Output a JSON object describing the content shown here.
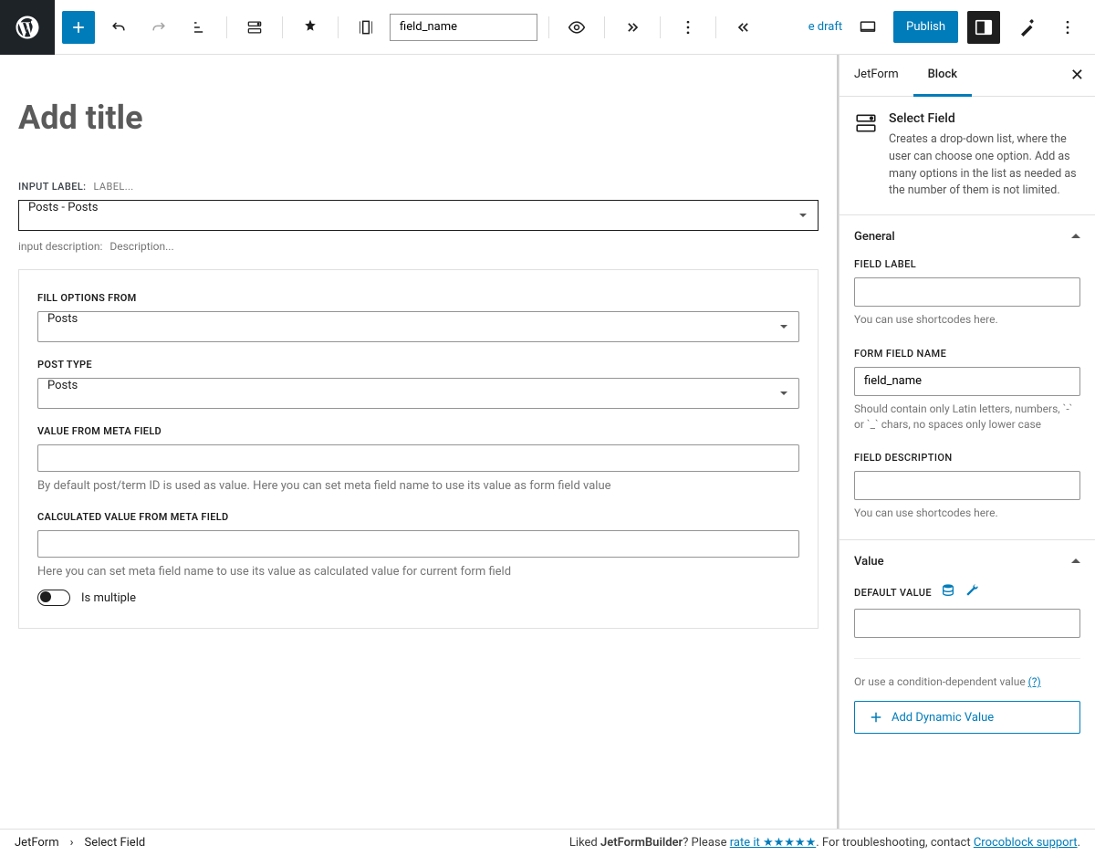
{
  "topbar": {
    "field_name_value": "field_name",
    "save_draft_partial": "e draft",
    "publish": "Publish"
  },
  "editor": {
    "title_placeholder": "Add title",
    "input_label_prefix": "INPUT LABEL:",
    "input_label_placeholder": "LABEL...",
    "select_value": "Posts - Posts",
    "input_desc_prefix": "input description:",
    "input_desc_placeholder": "Description...",
    "options": {
      "fill_from_label": "FILL OPTIONS FROM",
      "fill_from_value": "Posts",
      "post_type_label": "POST TYPE",
      "post_type_value": "Posts",
      "value_meta_label": "VALUE FROM META FIELD",
      "value_meta_hint": "By default post/term ID is used as value. Here you can set meta field name to use its value as form field value",
      "calc_meta_label": "CALCULATED VALUE FROM META FIELD",
      "calc_meta_hint": "Here you can set meta field name to use its value as calculated value for current form field",
      "is_multiple": "Is multiple"
    }
  },
  "sidebar": {
    "tabs": {
      "jetform": "JetForm",
      "block": "Block"
    },
    "block_name": "Select Field",
    "block_desc": "Creates a drop-down list, where the user can choose one option. Add as many options in the list as needed as the number of them is not limited.",
    "general": {
      "title": "General",
      "field_label": "FIELD LABEL",
      "field_label_hint": "You can use shortcodes here.",
      "form_field_name": "FORM FIELD NAME",
      "form_field_name_value": "field_name",
      "form_field_name_hint": "Should contain only Latin letters, numbers, `-` or `_` chars, no spaces only lower case",
      "field_desc": "FIELD DESCRIPTION",
      "field_desc_hint": "You can use shortcodes here."
    },
    "value": {
      "title": "Value",
      "default_label": "DEFAULT VALUE",
      "or_text": "Or use a condition-dependent value ",
      "or_link": "(?)",
      "add_dynamic": "Add Dynamic Value"
    }
  },
  "footer": {
    "crumb1": "JetForm",
    "crumb2": "Select Field",
    "liked": "Liked ",
    "product": "JetFormBuilder",
    "please": "? Please ",
    "rate": "rate it ★★★★★",
    "trouble": ". For troubleshooting, contact ",
    "support": "Crocoblock support",
    "dot": "."
  }
}
